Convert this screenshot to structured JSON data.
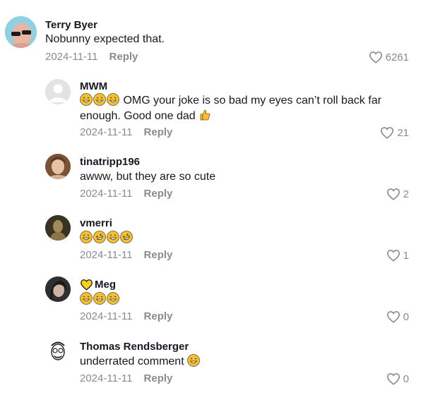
{
  "comments": [
    {
      "username": "Terry Byer",
      "text": "Nobunny expected that.",
      "date": "2024-11-11",
      "reply": "Reply",
      "likes": "6261",
      "avatar": "sunglasses-person-avatar"
    },
    {
      "username": "MWM",
      "text": "OMG your joke is so bad my eyes can’t roll back far enough. Good one dad",
      "date": "2024-11-11",
      "reply": "Reply",
      "likes": "21",
      "avatar": "default-gray-avatar"
    },
    {
      "username": "tinatripp196",
      "text": "awww, but they are so cute",
      "date": "2024-11-11",
      "reply": "Reply",
      "likes": "2",
      "avatar": "woman-avatar"
    },
    {
      "username": "vmerri",
      "text": "",
      "date": "2024-11-11",
      "reply": "Reply",
      "likes": "1",
      "avatar": "bust-statue-avatar"
    },
    {
      "username": "Meg",
      "text": "",
      "date": "2024-11-11",
      "reply": "Reply",
      "likes": "0",
      "avatar": "woman-dark-avatar"
    },
    {
      "username": "Thomas Rendsberger",
      "text": "underrated comment",
      "date": "2024-11-11",
      "reply": "Reply",
      "likes": "0",
      "avatar": "cartoon-sketch-avatar"
    }
  ],
  "colors": {
    "meta_gray": "#8a8b91",
    "text_dark": "#161823",
    "emoji_yellow": "#f7c02a"
  }
}
